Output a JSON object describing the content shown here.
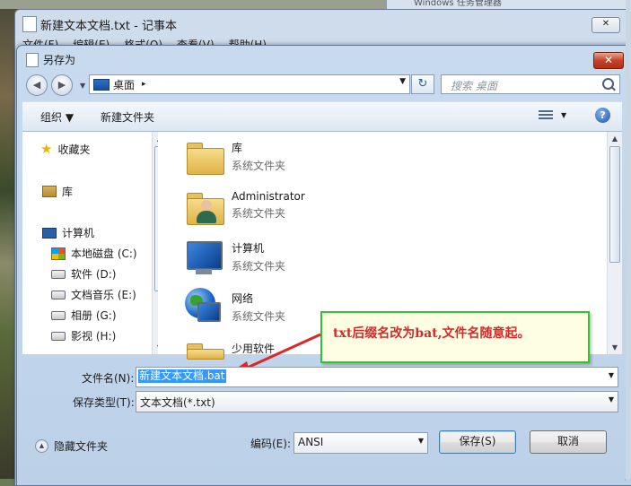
{
  "notepad": {
    "title": "新建文本文档.txt - 记事本",
    "menu": [
      "文件(F)",
      "编辑(E)",
      "格式(O)",
      "查看(V)",
      "帮助(H)"
    ],
    "behind_title": "Windows 任务管理器"
  },
  "dialog": {
    "title": "另存为",
    "close_label": "✕",
    "address": {
      "location": "桌面",
      "chevron": "▸"
    },
    "search_placeholder": "搜索 桌面",
    "toolbar": {
      "organize": "组织 ▼",
      "new_folder": "新建文件夹",
      "help": "?"
    },
    "nav": {
      "favorites": "收藏夹",
      "libraries": "库",
      "computer": "计算机",
      "drives": [
        "本地磁盘 (C:)",
        "软件 (D:)",
        "文档音乐 (E:)",
        "相册 (G:)",
        "影视 (H:)"
      ]
    },
    "files": [
      {
        "name": "库",
        "type": "系统文件夹"
      },
      {
        "name": "Administrator",
        "type": "系统文件夹"
      },
      {
        "name": "计算机",
        "type": "系统文件夹"
      },
      {
        "name": "网络",
        "type": "系统文件夹"
      },
      {
        "name": "少用软件",
        "type": ""
      }
    ],
    "filename_label": "文件名(N):",
    "filename_value": "新建文本文档.bat",
    "filetype_label": "保存类型(T):",
    "filetype_value": "文本文档(*.txt)",
    "hide_folders": "隐藏文件夹",
    "encoding_label": "编码(E):",
    "encoding_value": "ANSI",
    "save_button": "保存(S)",
    "cancel_button": "取消"
  },
  "annotation": {
    "callout_text": "txt后缀名改为bat,文件名随意起。",
    "colors": {
      "border": "#31c431",
      "text": "#d9272a",
      "fill": "#fefee2"
    }
  }
}
